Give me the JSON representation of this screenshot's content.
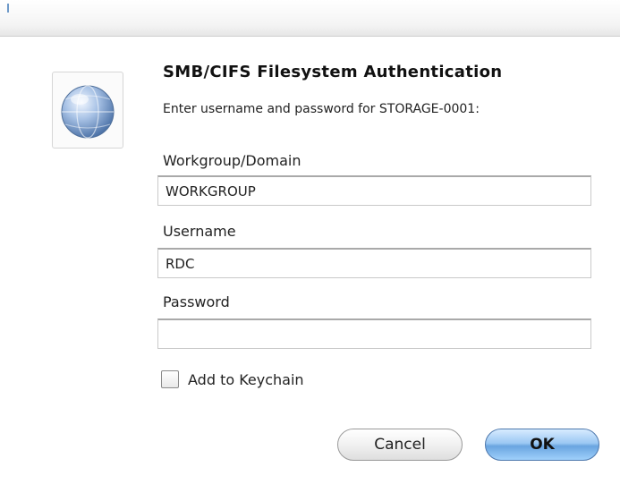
{
  "dialog": {
    "title": "SMB/CIFS Filesystem Authentication",
    "message": "Enter username and password for STORAGE-0001:",
    "icon": "network-globe-icon"
  },
  "fields": {
    "workgroup": {
      "label": "Workgroup/Domain",
      "value": "WORKGROUP"
    },
    "username": {
      "label": "Username",
      "value": "RDC"
    },
    "password": {
      "label": "Password",
      "value": ""
    }
  },
  "keychain": {
    "label": "Add to Keychain",
    "checked": false
  },
  "buttons": {
    "cancel": "Cancel",
    "ok": "OK"
  },
  "colors": {
    "ok_button": "#7fb4ea",
    "globe": "#6a93c4"
  }
}
